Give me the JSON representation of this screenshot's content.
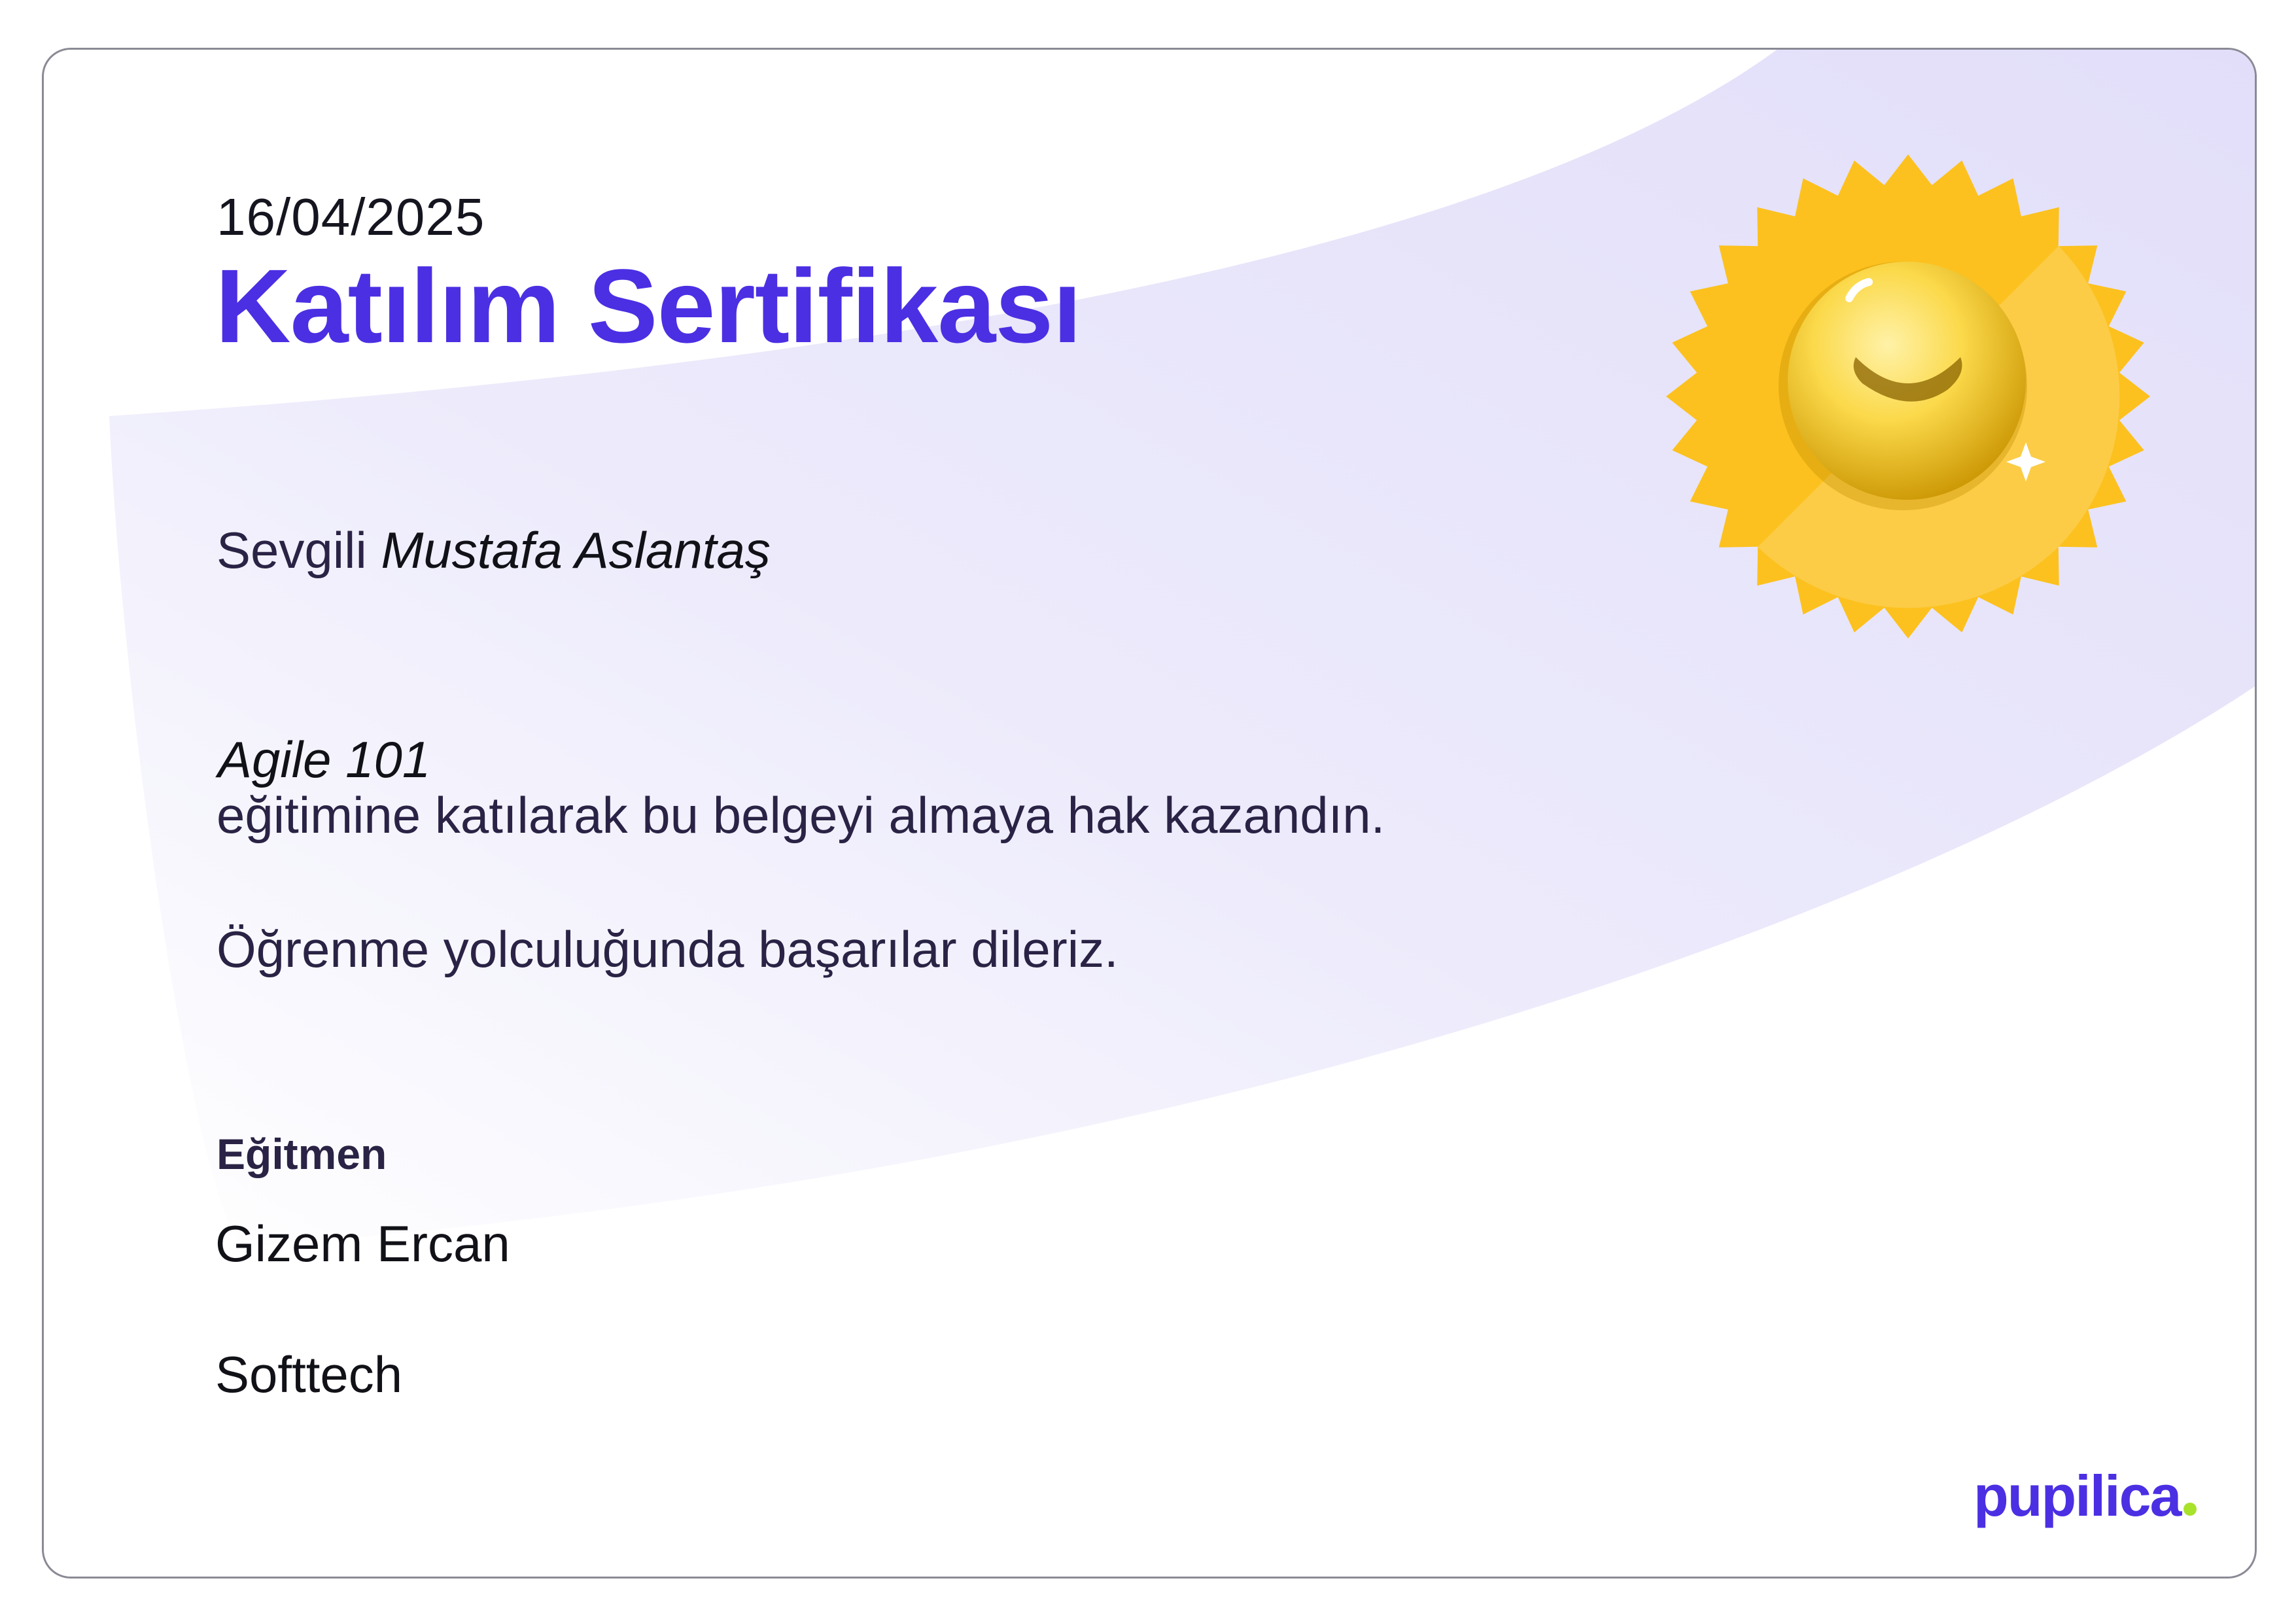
{
  "certificate": {
    "date": "16/04/2025",
    "title": "Katılım Sertifikası",
    "greeting_prefix": "Sevgili",
    "recipient_name": "Mustafa Aslantaş",
    "course_name": "Agile 101",
    "body_line_1": "eğitimine katılarak bu belgeyi almaya hak kazandın.",
    "body_line_2": "Öğrenme yolculuğunda başarılar dileriz.",
    "instructor_label": "Eğitmen",
    "instructor_name": "Gizem Ercan",
    "organization": "Softtech",
    "brand": "pupilica"
  },
  "colors": {
    "accent": "#4b2fe3",
    "badge_gold": "#fcc11e",
    "brand_dot": "#a8e22b",
    "swoosh": "#e6e2fa"
  }
}
